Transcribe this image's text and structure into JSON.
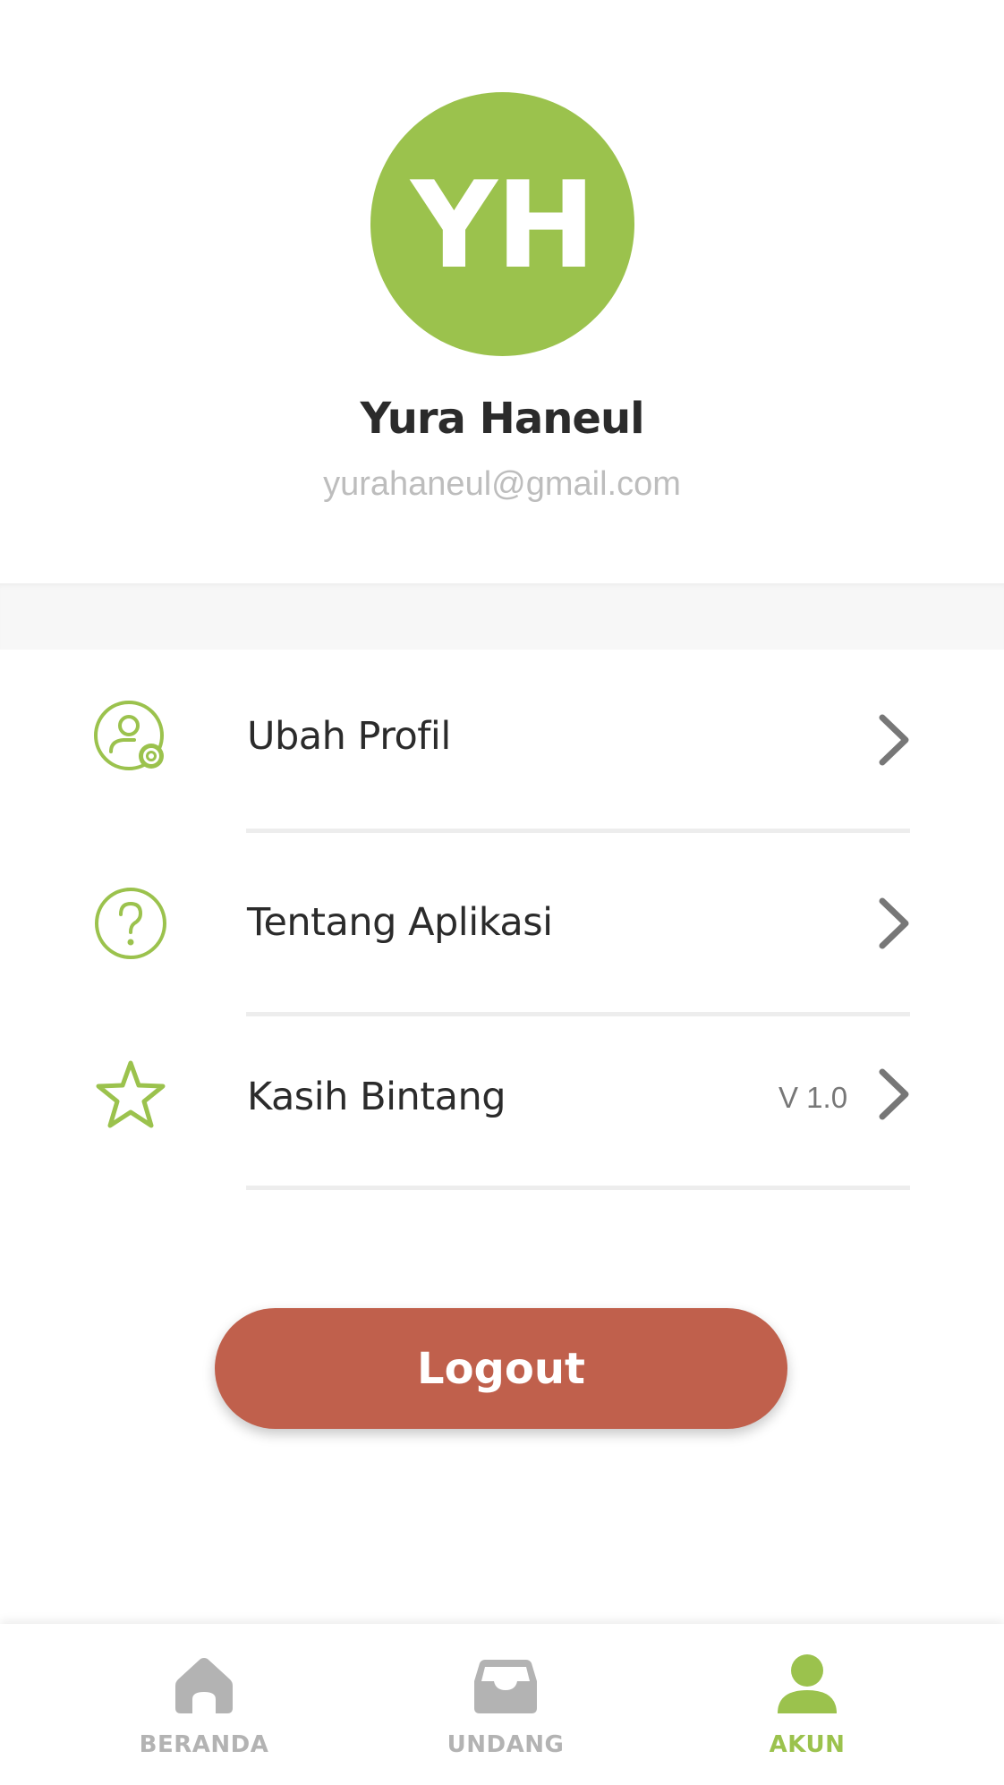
{
  "profile": {
    "initials": "YH",
    "name": "Yura Haneul",
    "email": "yurahaneul@gmail.com"
  },
  "menu": {
    "items": [
      {
        "label": "Ubah Profil",
        "icon": "user-settings-icon"
      },
      {
        "label": "Tentang Aplikasi",
        "icon": "question-circle-icon"
      },
      {
        "label": "Kasih Bintang",
        "icon": "star-icon",
        "extra": "V 1.0"
      }
    ]
  },
  "logout": {
    "label": "Logout"
  },
  "nav": {
    "items": [
      {
        "label": "BERANDA",
        "icon": "home-icon",
        "active": false
      },
      {
        "label": "UNDANG",
        "icon": "inbox-icon",
        "active": false
      },
      {
        "label": "AKUN",
        "icon": "user-icon",
        "active": true
      }
    ]
  },
  "colors": {
    "accent": "#9bc24d",
    "logout": "#c0604c",
    "inactive": "#b3b3b3",
    "text": "#2b2b2b",
    "chevron": "#777777"
  }
}
